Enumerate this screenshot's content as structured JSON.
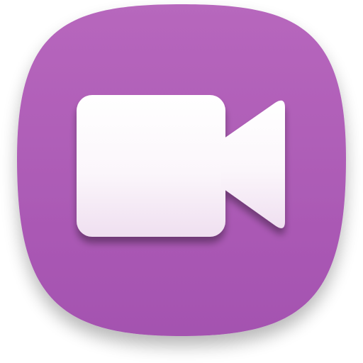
{
  "app_icon": {
    "icon_name": "video-camera-icon",
    "colors": {
      "tile_top": "#b767bd",
      "tile_bottom": "#a452b0",
      "glyph_top": "#ffffff",
      "glyph_bottom": "#efdff0",
      "shadow": "#000000"
    }
  }
}
